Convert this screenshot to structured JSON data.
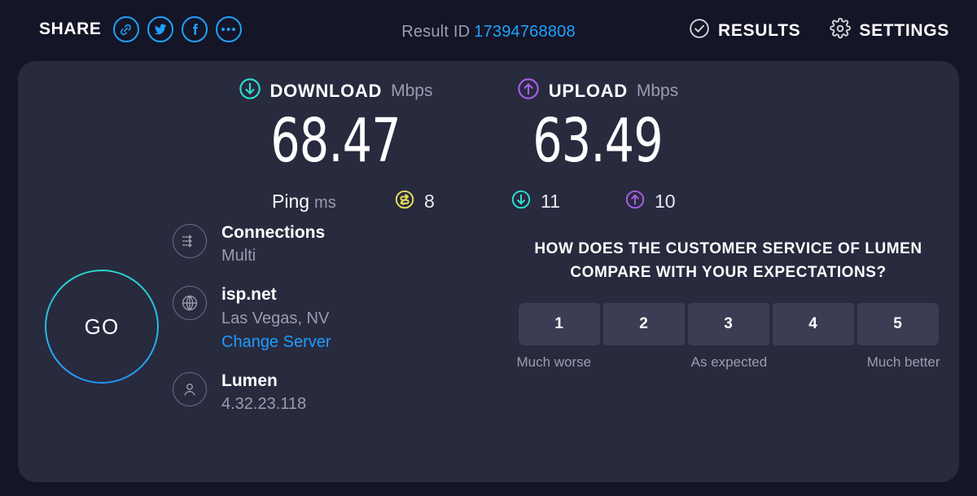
{
  "topbar": {
    "share_label": "SHARE",
    "share_buttons": [
      {
        "name": "link-icon",
        "title": "Copy link"
      },
      {
        "name": "twitter-icon",
        "title": "Share on Twitter"
      },
      {
        "name": "facebook-icon",
        "title": "Share on Facebook"
      },
      {
        "name": "ellipsis-icon",
        "title": "More share options"
      }
    ],
    "result_id_label": "Result ID",
    "result_id_value": "17394768808",
    "results_label": "RESULTS",
    "settings_label": "SETTINGS"
  },
  "speeds": {
    "download": {
      "label": "DOWNLOAD",
      "unit": "Mbps",
      "value": "68.47",
      "color": "#2ee0d0"
    },
    "upload": {
      "label": "UPLOAD",
      "unit": "Mbps",
      "value": "63.49",
      "color": "#a85fe8"
    }
  },
  "ping": {
    "label": "Ping",
    "unit": "ms",
    "idle": {
      "value": "8",
      "color": "#e8e05a"
    },
    "download": {
      "value": "11",
      "color": "#2ee0d0"
    },
    "upload": {
      "value": "10",
      "color": "#a85fe8"
    }
  },
  "go_button": {
    "label": "GO"
  },
  "info": {
    "connections": {
      "title": "Connections",
      "value": "Multi"
    },
    "server": {
      "title": "isp.net",
      "value": "Las Vegas, NV",
      "link": "Change Server"
    },
    "client": {
      "title": "Lumen",
      "value": "4.32.23.118"
    }
  },
  "survey": {
    "question": "HOW DOES THE CUSTOMER SERVICE OF LUMEN COMPARE WITH YOUR EXPECTATIONS?",
    "options": [
      "1",
      "2",
      "3",
      "4",
      "5"
    ],
    "legend_low": "Much worse",
    "legend_mid": "As expected",
    "legend_high": "Much better"
  },
  "colors": {
    "page_background": "#141526",
    "card_background": "#282a3e",
    "accent_blue": "#1fa2ff",
    "rating_button": "#3a3d54"
  }
}
